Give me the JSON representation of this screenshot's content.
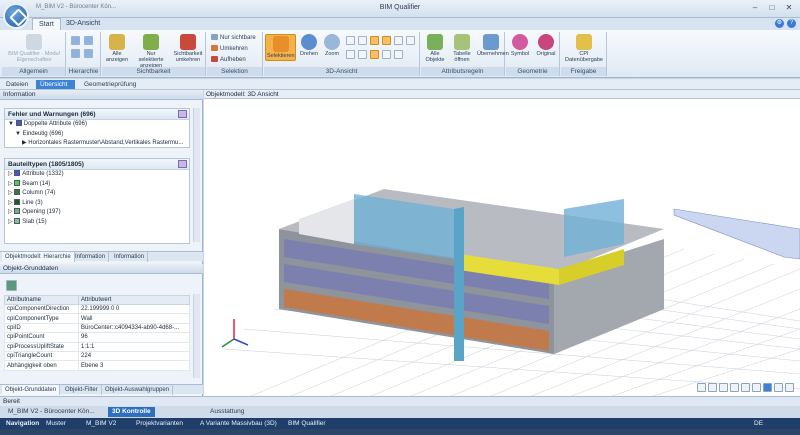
{
  "window": {
    "title": "BIM Qualifier",
    "quick_access": "M_BIM V2 - Bürocenter Kön..."
  },
  "tabs": [
    {
      "label": "Start"
    },
    {
      "label": "3D-Ansicht"
    }
  ],
  "ribbon": {
    "groups": [
      {
        "label": "Allgemein"
      },
      {
        "label": "Hierarchie"
      },
      {
        "label": "Sichtbarkeit"
      },
      {
        "label": "Selektion"
      },
      {
        "label": "3D-Ansicht"
      },
      {
        "label": "Attributsregeln"
      },
      {
        "label": "Geometrie"
      },
      {
        "label": "Freigabe"
      }
    ],
    "allgemein_btn": "BIM Qualifier - Modul Eigenschaften",
    "alle_anzeigen": "Alle anzeigen",
    "nur_selektierte": "Nur selektierte anzeigen",
    "sichtbarkeit_umkehren": "Sichtbarkeit umkehren",
    "nur_sichtbare": "Nur sichtbare",
    "umkehren": "Umkehren",
    "aufheben": "Aufheben",
    "selektieren": "Selektieren",
    "drehen": "Drehen",
    "zoom": "Zoom",
    "alle_objekte": "Alle Objekte",
    "tabelle_oeffnen": "Tabelle öffnen",
    "uebernehmen": "Übernehmen",
    "symbol": "Symbol",
    "original": "Original",
    "cpi": "CPI Datenübergabe"
  },
  "breadcrumb": [
    "Dateien",
    "Übersicht",
    "Geometrieprüfung"
  ],
  "left": {
    "info_header": "Information",
    "errors": {
      "title": "Fehler und Warnungen (696)",
      "rows": [
        "Doppelte Attribute (696)",
        "Eindeutig (696)",
        "Horizontales Rastermuster\\Abstand,Vertikales Rastermu..."
      ]
    },
    "types": {
      "title": "Bauteiltypen (1805/1805)",
      "rows": [
        {
          "label": "Attribute (1332)",
          "color": "#3a5bd8"
        },
        {
          "label": "Beam (14)",
          "color": "#4ad04a"
        },
        {
          "label": "Column (74)",
          "color": "#2e7d32"
        },
        {
          "label": "Line (3)",
          "color": "#1b5e20"
        },
        {
          "label": "Opening (197)",
          "color": "#66bb6a"
        },
        {
          "label": "Slab (15)",
          "color": "#81c784"
        }
      ]
    },
    "tabs_top": [
      "Objektmodell: Hierarchie",
      "Information",
      "Information"
    ],
    "props_header": "Objekt-Grunddaten",
    "table": {
      "headers": [
        "Attributname",
        "Attributwert"
      ],
      "rows": [
        [
          "cpiComponentDirection",
          "22.199999 0 0"
        ],
        [
          "cpiComponentType",
          "Wall"
        ],
        [
          "cpiID",
          "BüroCenter::c4094334-ab90-4d68-..."
        ],
        [
          "cpiPointCount",
          "96"
        ],
        [
          "cpiProcessUpliftState",
          "1:1:1"
        ],
        [
          "cpiTriangleCount",
          "224"
        ],
        [
          "Abhängigkeit oben",
          "Ebene 3"
        ]
      ]
    },
    "tabs_bottom": [
      "Objekt-Grunddaten",
      "Objekt-Filter",
      "Objekt-Auswahlgruppen"
    ]
  },
  "view": {
    "header": "Objektmodell: 3D Ansicht"
  },
  "status": "Bereit",
  "docs": [
    "M_BIM V2 - Bürocenter Kön...",
    "3D Kontrolle",
    "Ausstattung"
  ],
  "nav": {
    "label": "Navigation",
    "path": [
      "Muster",
      "M_BIM V2",
      "Projektvarianten",
      "A Variante Massivbau (3D)",
      "BIM Qualifier"
    ],
    "lang": "DE"
  }
}
